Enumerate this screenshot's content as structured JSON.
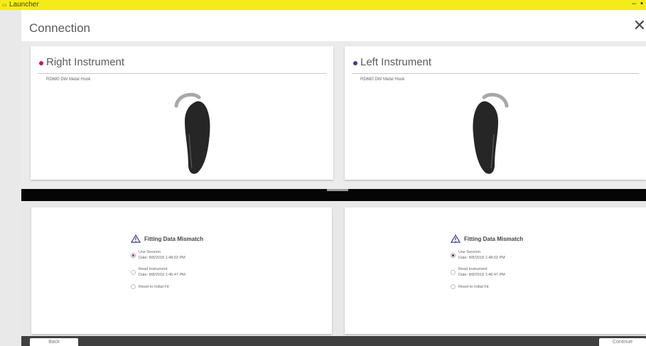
{
  "window": {
    "title": "Launcher",
    "controls": {
      "minimize": "–",
      "maximize": "▪"
    }
  },
  "header": {
    "title": "Connection",
    "close_glyph": "✕"
  },
  "colors": {
    "right_accent": "#c2185b",
    "left_accent": "#303f9f",
    "titlebar": "#f3ec1a"
  },
  "instruments": {
    "right": {
      "heading": "Right Instrument",
      "model": "RD680 DW  Metal Hook"
    },
    "left": {
      "heading": "Left Instrument",
      "model": "RD680 DW  Metal Hook"
    }
  },
  "mismatch": {
    "right": {
      "title": "Fitting Data Mismatch",
      "options": [
        {
          "line1": "Use Session",
          "line2": "Date: 8/8/2018 1:48:03 PM",
          "selected": true
        },
        {
          "line1": "Read Instrument",
          "line2": "Date: 8/8/2018 1:46:47 PM",
          "selected": false
        },
        {
          "line1": "Reset to Initial Fit",
          "selected": false
        }
      ]
    },
    "left": {
      "title": "Fitting Data Mismatch",
      "options": [
        {
          "line1": "Use Session",
          "line2": "Date: 8/8/2018 1:48:03 PM",
          "selected": true
        },
        {
          "line1": "Read Instrument",
          "line2": "Date: 8/8/2018 1:46:47 PM",
          "selected": false
        },
        {
          "line1": "Reset to Initial Fit",
          "selected": false
        }
      ]
    }
  },
  "footer": {
    "back_label": "Back",
    "continue_label": "Continue"
  }
}
